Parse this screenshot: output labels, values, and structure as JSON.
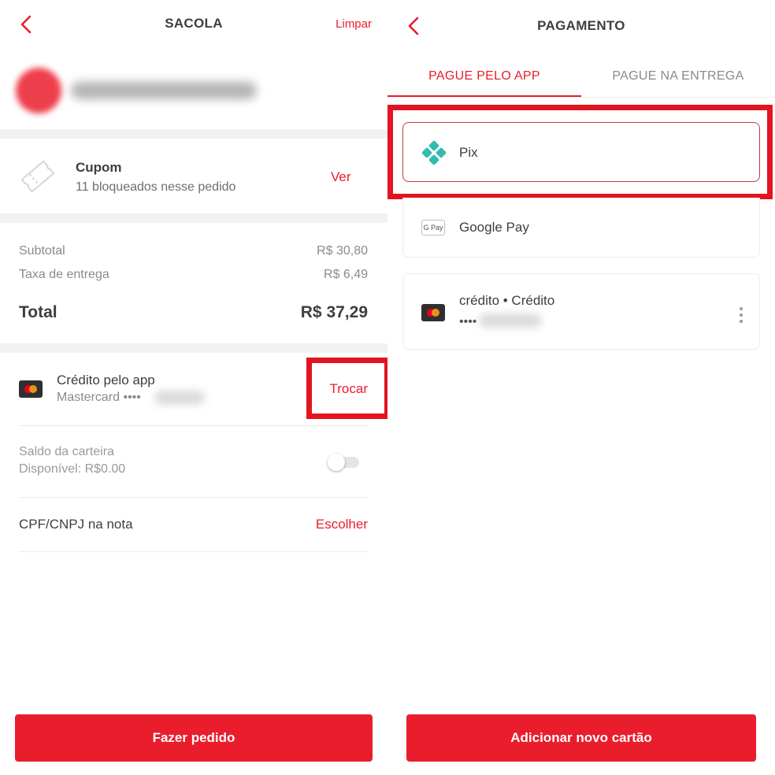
{
  "sacola": {
    "title": "SACOLA",
    "clear_label": "Limpar",
    "coupon": {
      "title": "Cupom",
      "subtitle": "11 bloqueados nesse pedido",
      "action": "Ver"
    },
    "summary": {
      "subtotal_label": "Subtotal",
      "subtotal_value": "R$ 30,80",
      "delivery_label": "Taxa de entrega",
      "delivery_value": "R$ 6,49",
      "total_label": "Total",
      "total_value": "R$ 37,29"
    },
    "payment": {
      "method": "Crédito pelo app",
      "card": "Mastercard ••••",
      "action": "Trocar"
    },
    "wallet": {
      "label": "Saldo da carteira",
      "available": "Disponível: R$0.00",
      "enabled": false
    },
    "cpf": {
      "label": "CPF/CNPJ na nota",
      "action": "Escolher"
    },
    "submit_label": "Fazer pedido"
  },
  "pagamento": {
    "title": "PAGAMENTO",
    "tabs": [
      {
        "label": "PAGUE PELO APP",
        "active": true
      },
      {
        "label": "PAGUE NA ENTREGA",
        "active": false
      }
    ],
    "methods": [
      {
        "label": "Pix",
        "icon": "pix-icon",
        "selected": true
      },
      {
        "label": "Google Pay",
        "icon": "google-pay-icon",
        "icon_text": "G Pay",
        "selected": false
      }
    ],
    "saved_card": {
      "label": "crédito • Crédito",
      "masked": "••••",
      "icon": "mastercard-icon"
    },
    "add_card_label": "Adicionar novo cartão"
  },
  "colors": {
    "accent": "#ea1d2c",
    "highlight_box": "#e1141f",
    "pix": "#32bcad",
    "separator": "#f2f2f2"
  }
}
